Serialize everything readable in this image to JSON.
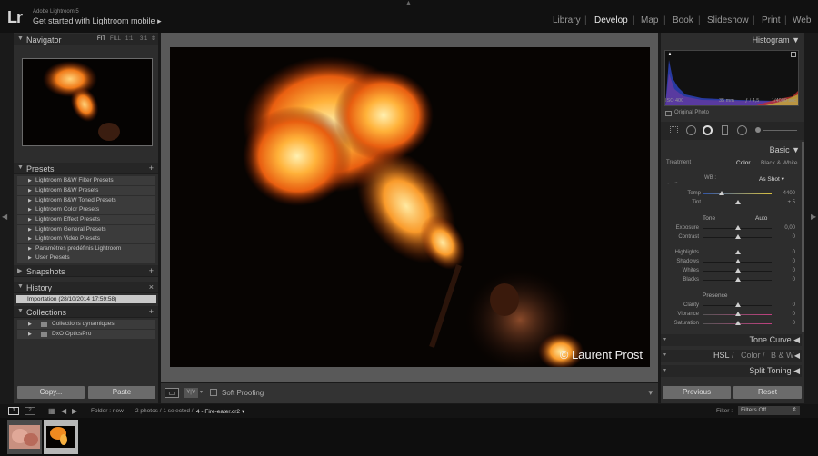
{
  "header": {
    "logo": "Lr",
    "app_name": "Adobe Lightroom 5",
    "promo": "Get started with Lightroom mobile",
    "promo_arrow": "▸",
    "modules": [
      "Library",
      "Develop",
      "Map",
      "Book",
      "Slideshow",
      "Print",
      "Web"
    ],
    "active_module": "Develop",
    "separator": "|"
  },
  "navigator": {
    "title": "Navigator",
    "zoom": [
      "FIT",
      "FILL",
      "1:1",
      "3:1"
    ],
    "zoom_arrow": "⇕"
  },
  "presets": {
    "title": "Presets",
    "add": "+",
    "items": [
      "Lightroom B&W Filter Presets",
      "Lightroom B&W Presets",
      "Lightroom B&W Toned Presets",
      "Lightroom Color Presets",
      "Lightroom Effect Presets",
      "Lightroom General Presets",
      "Lightroom Video Presets",
      "Paramètres prédéfinis Lightroom",
      "User Presets"
    ]
  },
  "snapshots": {
    "title": "Snapshots",
    "add": "+"
  },
  "history": {
    "title": "History",
    "clear": "×",
    "items": [
      "Importation (28/10/2014 17:59:58)"
    ]
  },
  "collections": {
    "title": "Collections",
    "add": "+",
    "items": [
      "Collections dynamiques",
      "DxO OpticsPro"
    ]
  },
  "left_buttons": {
    "copy": "Copy...",
    "paste": "Paste"
  },
  "photo": {
    "watermark": "© Laurent Prost"
  },
  "toolbar": {
    "view_icon": "▭",
    "compare_label": "Y|Y",
    "soft_proofing": "Soft Proofing",
    "more": "▾"
  },
  "histogram": {
    "title": "Histogram",
    "iso": "ISO 400",
    "focal": "35 mm",
    "aperture": "ƒ / 4,5",
    "shutter": "1/4000 sec",
    "original_photo": "Original Photo"
  },
  "basic": {
    "title": "Basic",
    "treatment_label": "Treatment :",
    "treatment_color": "Color",
    "treatment_bw": "Black & White",
    "wb_label": "WB :",
    "wb_value": "As Shot",
    "temp_label": "Temp",
    "temp_value": "4400",
    "tint_label": "Tint",
    "tint_value": "+ 5",
    "tone_label": "Tone",
    "auto_label": "Auto",
    "tone_sliders": [
      {
        "label": "Exposure",
        "value": "0,00"
      },
      {
        "label": "Contrast",
        "value": "0"
      },
      {
        "label": "Highlights",
        "value": "0"
      },
      {
        "label": "Shadows",
        "value": "0"
      },
      {
        "label": "Whites",
        "value": "0"
      },
      {
        "label": "Blacks",
        "value": "0"
      }
    ],
    "presence_label": "Presence",
    "presence_sliders": [
      {
        "label": "Clarity",
        "value": "0"
      },
      {
        "label": "Vibrance",
        "value": "0"
      },
      {
        "label": "Saturation",
        "value": "0"
      }
    ]
  },
  "right_sections": {
    "tone_curve": "Tone Curve",
    "hsl": "HSL",
    "color": "Color",
    "bw": "B & W",
    "split_toning": "Split Toning",
    "slash": "/"
  },
  "right_buttons": {
    "previous": "Previous",
    "reset": "Reset"
  },
  "filmstrip_bar": {
    "screen1": "1",
    "screen2": "2",
    "folder_label": "Folder : new",
    "count": "2 photos / 1 selected /",
    "filename": "4 - Fire-eater.cr2",
    "filter_label": "Filter :",
    "filter_value": "Filters Off"
  },
  "colors": {
    "accent": "#e8e8e8",
    "panel": "#2d2d2d",
    "selected_row": "#c9c9c9"
  }
}
